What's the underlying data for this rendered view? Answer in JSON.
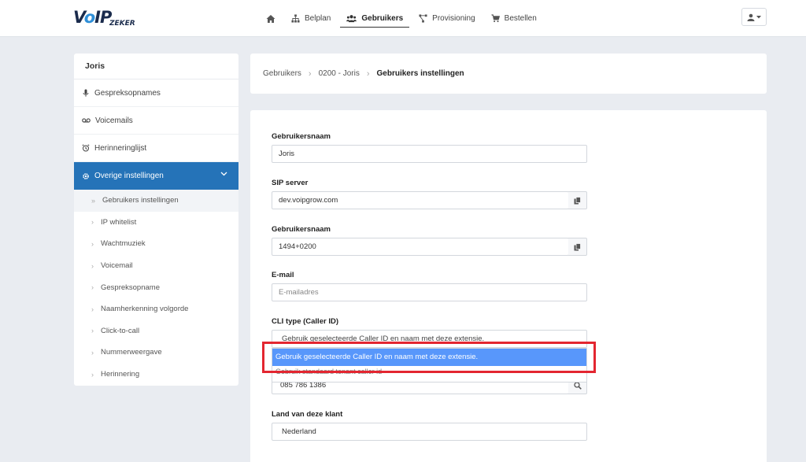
{
  "logo": {
    "big": "VoIP",
    "small": "ZEKER"
  },
  "nav": {
    "home_label": "",
    "items": [
      {
        "label": "Belplan"
      },
      {
        "label": "Gebruikers"
      },
      {
        "label": "Provisioning"
      },
      {
        "label": "Bestellen"
      }
    ]
  },
  "sidebar": {
    "title": "Joris",
    "items": [
      {
        "label": "Gespreksopnames"
      },
      {
        "label": "Voicemails"
      },
      {
        "label": "Herinneringlijst"
      },
      {
        "label": "Overige instellingen"
      }
    ],
    "subitems": [
      {
        "label": "Gebruikers instellingen"
      },
      {
        "label": "IP whitelist"
      },
      {
        "label": "Wachtmuziek"
      },
      {
        "label": "Voicemail"
      },
      {
        "label": "Gespreksopname"
      },
      {
        "label": "Naamherkenning volgorde"
      },
      {
        "label": "Click-to-call"
      },
      {
        "label": "Nummerweergave"
      },
      {
        "label": "Herinnering"
      }
    ]
  },
  "breadcrumb": {
    "items": [
      "Gebruikers",
      "0200 - Joris"
    ],
    "current": "Gebruikers instellingen"
  },
  "form": {
    "username_label": "Gebruikersnaam",
    "username_value": "Joris",
    "sip_label": "SIP server",
    "sip_value": "dev.voipgrow.com",
    "sip_user_label": "Gebruikersnaam",
    "sip_user_value": "1494+0200",
    "email_label": "E-mail",
    "email_placeholder": "E-mailadres",
    "cli_label": "CLI type (Caller ID)",
    "cli_value": "Gebruik geselecteerde Caller ID en naam met deze extensie.",
    "cli_options": [
      "Gebruik geselecteerde Caller ID en naam met deze extensie.",
      "Gebruik standaard tenant caller id"
    ],
    "callerid_value": "085 786 1386",
    "country_label": "Land van deze klant",
    "country_value": "Nederland"
  },
  "colors": {
    "accent": "#2573b8",
    "highlight": "#5897fb",
    "annotation": "#e32630"
  },
  "icons": {
    "home": "home-icon",
    "belplan": "sitemap-icon",
    "users": "users-icon",
    "provisioning": "network-icon",
    "order": "cart-icon",
    "copy": "copy-icon",
    "search": "search-icon"
  }
}
